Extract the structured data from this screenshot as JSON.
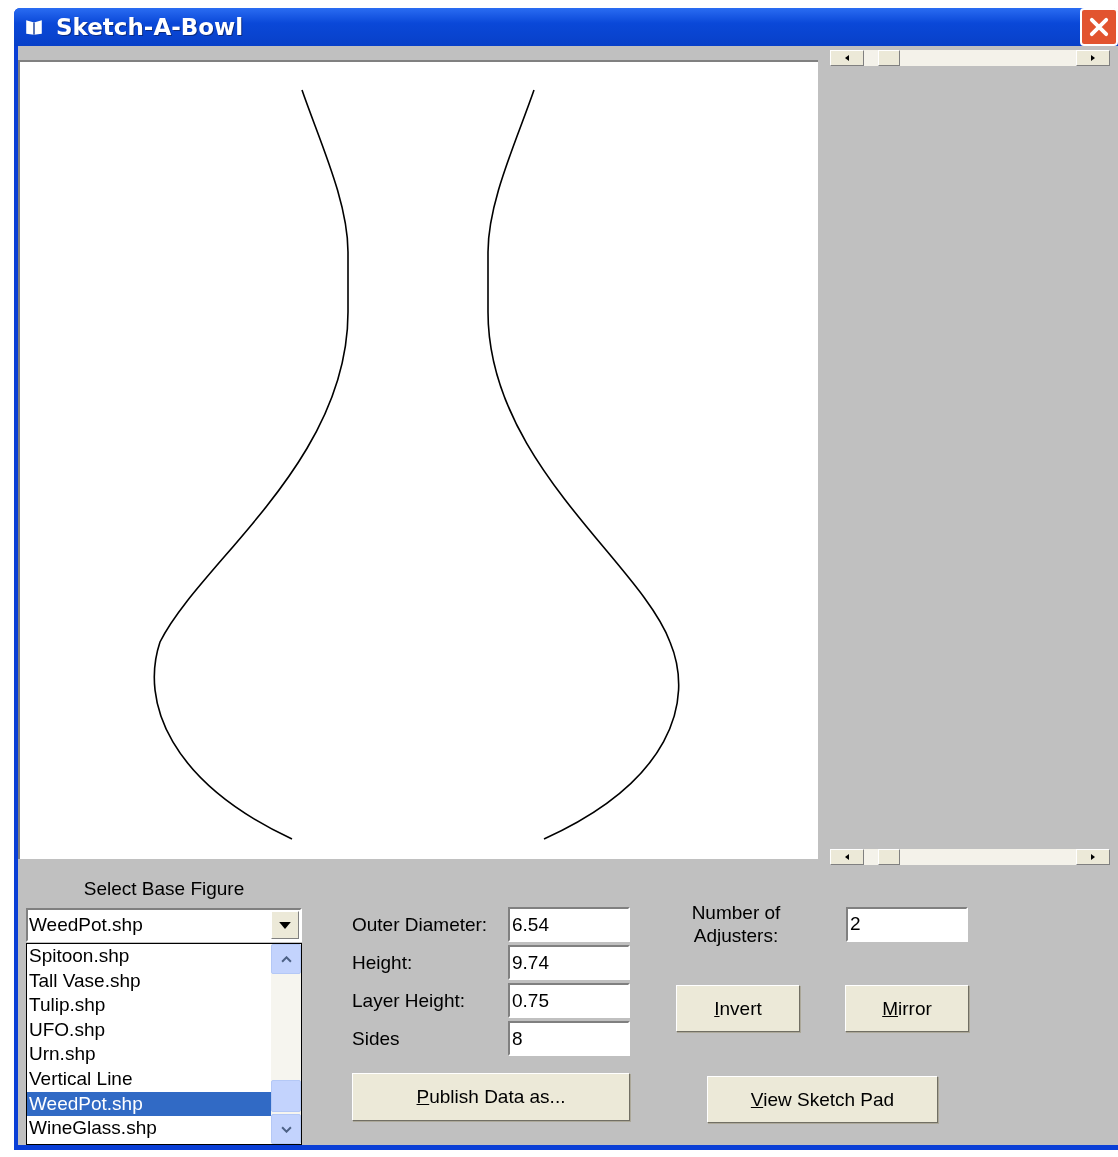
{
  "window": {
    "title": "Sketch-A-Bowl"
  },
  "base_figure": {
    "label": "Select Base Figure",
    "value": "WeedPot.shp",
    "options": [
      {
        "label": "Spitoon.shp",
        "selected": false
      },
      {
        "label": "Tall Vase.shp",
        "selected": false
      },
      {
        "label": "Tulip.shp",
        "selected": false
      },
      {
        "label": "UFO.shp",
        "selected": false
      },
      {
        "label": "Urn.shp",
        "selected": false
      },
      {
        "label": "Vertical Line",
        "selected": false
      },
      {
        "label": "WeedPot.shp",
        "selected": true
      },
      {
        "label": "WineGlass.shp",
        "selected": false
      }
    ]
  },
  "fields": [
    {
      "label": "Outer Diameter:",
      "value": "6.54"
    },
    {
      "label": "Height:",
      "value": "9.74"
    },
    {
      "label": "Layer Height:",
      "value": "0.75"
    },
    {
      "label": "Sides",
      "value": "8"
    }
  ],
  "adjusters": {
    "label": "Number of Adjusters:",
    "value": "2"
  },
  "shape_buttons": [
    {
      "label": "Invert"
    },
    {
      "label": "Mirror"
    }
  ],
  "publish_button": {
    "label": "Publish Data as..."
  },
  "sketch_button": {
    "label": "View Sketch Pad"
  }
}
